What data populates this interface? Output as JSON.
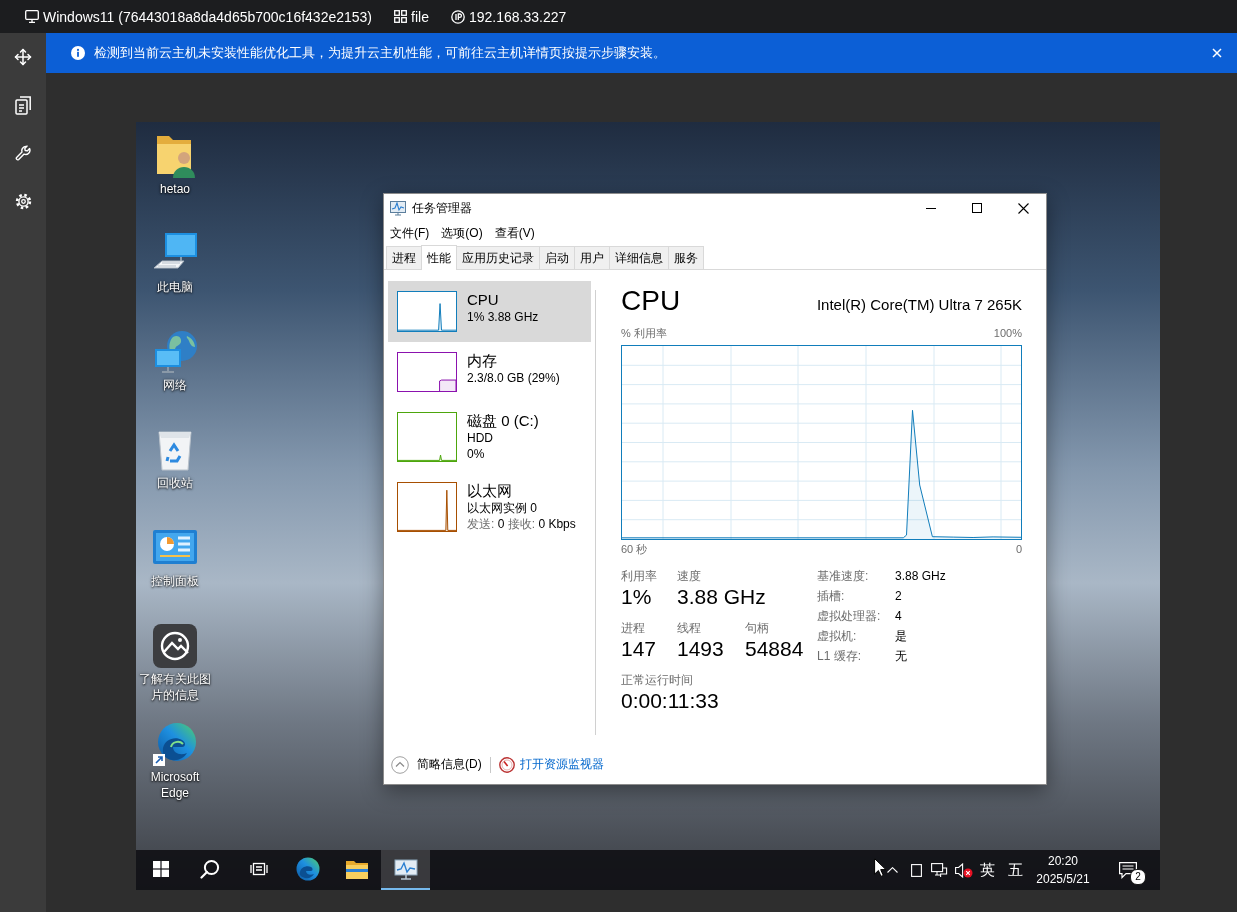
{
  "top_bar": {
    "items": [
      {
        "kind": "machine",
        "label": "Windows11 (76443018a8da4d65b700c16f432e2153)"
      },
      {
        "kind": "files",
        "label": "file"
      },
      {
        "kind": "ip",
        "label": "192.168.33.227"
      }
    ]
  },
  "notice": {
    "text": "检测到当前云主机未安装性能优化工具，为提升云主机性能，可前往云主机详情页按提示步骤安装。"
  },
  "desktop": {
    "icons": [
      {
        "kind": "user-folder",
        "label": "hetao"
      },
      {
        "kind": "computer",
        "label": "此电脑"
      },
      {
        "kind": "network",
        "label": "网络"
      },
      {
        "kind": "recycle-bin",
        "label": "回收站"
      },
      {
        "kind": "control-panel",
        "label": "控制面板"
      },
      {
        "kind": "picture-info",
        "label": "了解有关此图片的信息"
      },
      {
        "kind": "browser",
        "label": "Microsoft Edge"
      }
    ]
  },
  "task_manager": {
    "title": "任务管理器",
    "menu": [
      "文件(F)",
      "选项(O)",
      "查看(V)"
    ],
    "tabs": [
      {
        "label": "进程",
        "selected": false
      },
      {
        "label": "性能",
        "selected": true
      },
      {
        "label": "应用历史记录",
        "selected": false
      },
      {
        "label": "启动",
        "selected": false
      },
      {
        "label": "用户",
        "selected": false
      },
      {
        "label": "详细信息",
        "selected": false
      },
      {
        "label": "服务",
        "selected": false
      }
    ],
    "resources": [
      {
        "kind": "cpu",
        "name": "CPU",
        "details": [
          "1% 3.88 GHz"
        ],
        "color": "#117dbb",
        "selected": true
      },
      {
        "kind": "memory",
        "name": "内存",
        "details": [
          "2.3/8.0 GB (29%)"
        ],
        "color": "#8b12ae",
        "selected": false
      },
      {
        "kind": "disk",
        "name": "磁盘 0 (C:)",
        "details": [
          "HDD",
          "0%"
        ],
        "color": "#4da60c",
        "selected": false
      },
      {
        "kind": "ethernet",
        "name": "以太网",
        "details": [
          "以太网实例 0"
        ],
        "throughput": [
          {
            "label": "发送:",
            "value": "0"
          },
          {
            "label": "接收:",
            "value": "0 Kbps"
          }
        ],
        "color": "#a74f01",
        "selected": false
      }
    ],
    "detail": {
      "title": "CPU",
      "model": "Intel(R) Core(TM) Ultra 7 265K",
      "graph": {
        "y_label": "% 利用率",
        "y_max_label": "100%",
        "x_start_label": "60 秒",
        "x_end_label": "0"
      },
      "stats": [
        [
          {
            "label": "利用率",
            "value": "1%"
          },
          {
            "label": "速度",
            "value": "3.88 GHz"
          }
        ],
        [
          {
            "label": "进程",
            "value": "147"
          },
          {
            "label": "线程",
            "value": "1493"
          },
          {
            "label": "句柄",
            "value": "54884"
          }
        ],
        [
          {
            "label": "正常运行时间",
            "value": "0:00:11:33"
          }
        ]
      ],
      "specs": [
        {
          "label": "基准速度:",
          "value": "3.88 GHz"
        },
        {
          "label": "插槽:",
          "value": "2"
        },
        {
          "label": "虚拟处理器:",
          "value": "4"
        },
        {
          "label": "虚拟机:",
          "value": "是"
        },
        {
          "label": "L1 缓存:",
          "value": "无"
        }
      ]
    },
    "footer": {
      "summary": "简略信息(D)",
      "link": "打开资源监视器"
    }
  },
  "taskbar": {
    "buttons": [
      {
        "kind": "start",
        "active": false
      },
      {
        "kind": "search",
        "active": false
      },
      {
        "kind": "task-view",
        "active": false
      },
      {
        "kind": "browser",
        "active": false
      },
      {
        "kind": "folder",
        "active": false
      },
      {
        "kind": "task-manager",
        "active": true
      }
    ],
    "input_language": "英",
    "ime_mode": "五",
    "time": "20:20",
    "date": "2025/5/21",
    "notification_count": "2"
  }
}
